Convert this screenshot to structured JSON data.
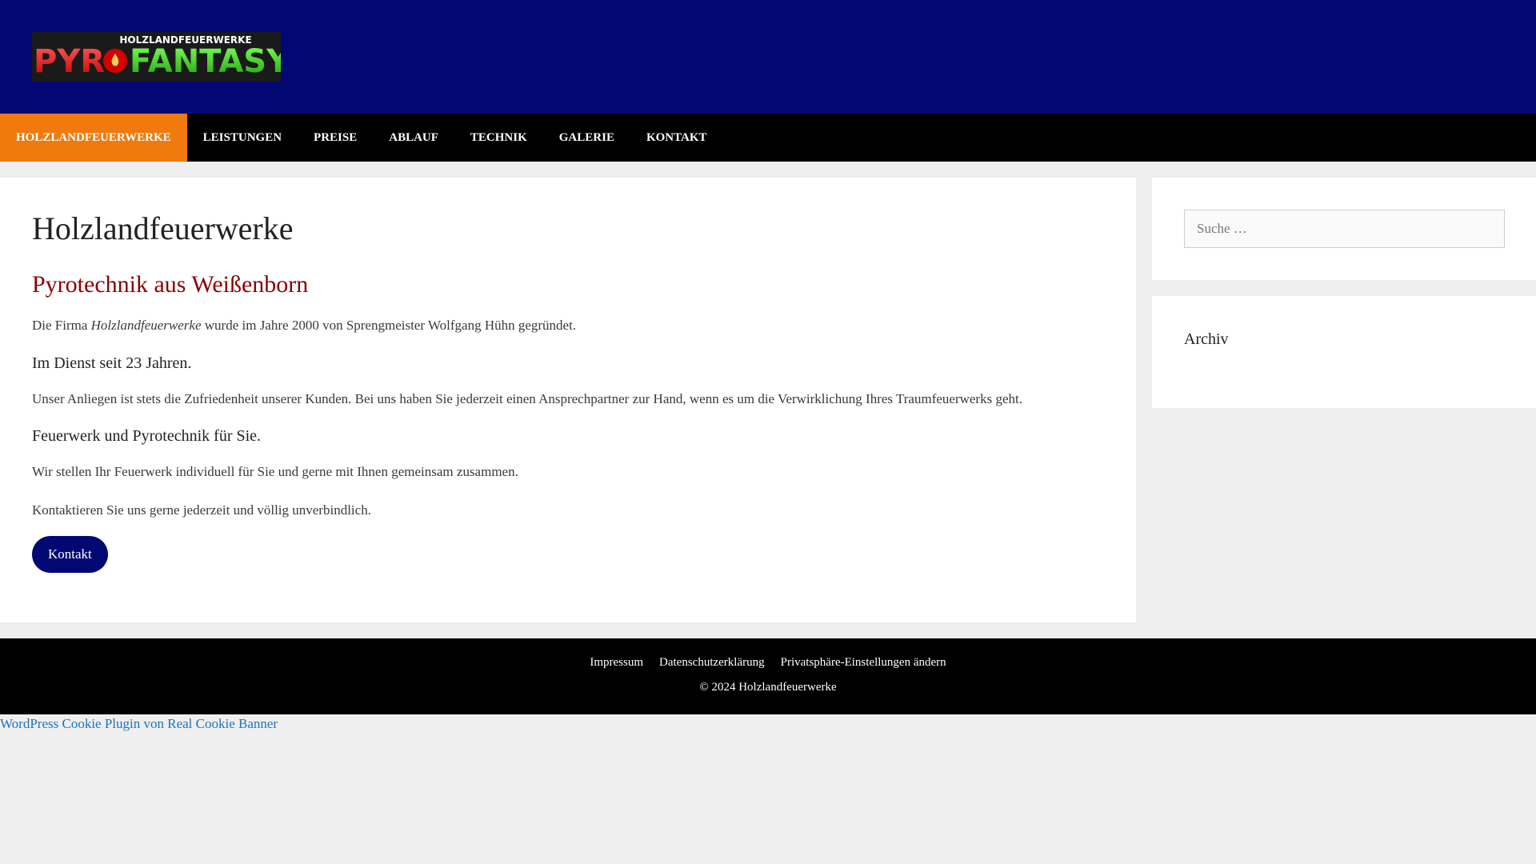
{
  "header": {
    "logo": {
      "top_text": "HOLZLANDFEUERWERKE",
      "left_text": "PYR",
      "right_text": "FANTASY"
    }
  },
  "nav": {
    "items": [
      {
        "label": "Holzlandfeuerwerke",
        "active": true
      },
      {
        "label": "Leistungen"
      },
      {
        "label": "Preise"
      },
      {
        "label": "Ablauf"
      },
      {
        "label": "Technik"
      },
      {
        "label": "Galerie"
      },
      {
        "label": "Kontakt"
      }
    ]
  },
  "main": {
    "title": "Holzlandfeuerwerke",
    "subtitle": "Pyrotechnik aus Weißenborn",
    "intro_before": "Die Firma ",
    "intro_em": "Holzlandfeuerwerke",
    "intro_after": " wurde im Jahre 2000 von Sprengmeister Wolfgang Hühn gegründet.",
    "heading_1": "Im Dienst seit 23 Jahren.",
    "para_1": "Unser Anliegen ist stets die Zufriedenheit unserer Kunden. Bei uns haben Sie jederzeit einen Ansprechpartner zur Hand, wenn es um die Verwirklichung Ihres Traumfeuerwerks geht.",
    "heading_2": "Feuerwerk und Pyrotechnik für Sie.",
    "para_2": "Wir stellen Ihr Feuerwerk individuell für Sie und gerne mit Ihnen gemeinsam zusammen.",
    "para_3": "Kontaktieren Sie uns gerne jederzeit und völlig unverbindlich.",
    "button_label": "Kontakt"
  },
  "sidebar": {
    "search_placeholder": "Suche …",
    "archive_title": "Archiv"
  },
  "footer": {
    "links": [
      "Impressum",
      "Datenschutzerklärung",
      "Privatsphäre-Einstellungen ändern"
    ],
    "copyright": "© 2024 Holzlandfeuerwerke"
  },
  "cookie_link": "WordPress Cookie Plugin von Real Cookie Banner",
  "colors": {
    "header_bg": "#020873",
    "nav_bg": "#000000",
    "active_nav": "#f07a0d",
    "subtitle": "#8c0000",
    "button": "#020873",
    "link": "#1e73be"
  }
}
